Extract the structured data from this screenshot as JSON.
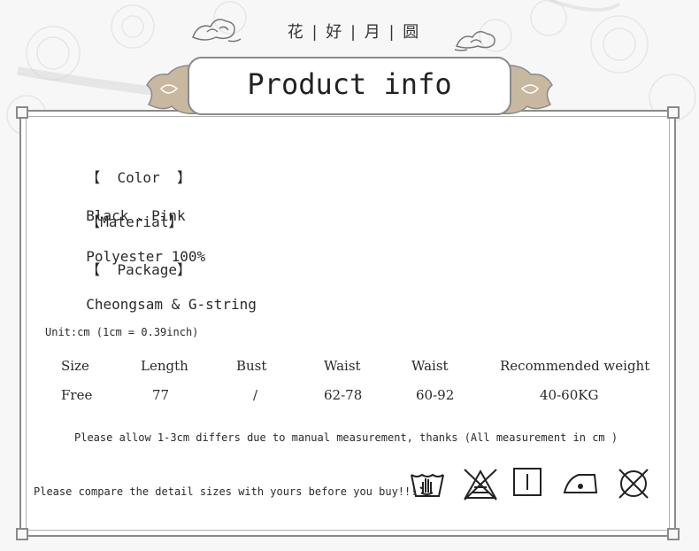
{
  "header": {
    "chinese_title": "花 | 好 | 月 | 圆",
    "banner_title": "Product info"
  },
  "details": [
    {
      "label": "【  Color  】",
      "value": "Black 、Pink"
    },
    {
      "label": "【Material】",
      "value": "Polyester 100%"
    },
    {
      "label": "【  Package】",
      "value": "Cheongsam & G-string"
    }
  ],
  "size_chart": {
    "unit_note": "Unit:cm (1cm = 0.39inch)",
    "columns": [
      "Size",
      "Length",
      "Bust",
      "Waist",
      "Waist",
      "Recommended weight"
    ],
    "rows": [
      [
        "Free",
        "77",
        "/",
        "62-78",
        "60-92",
        "40-60KG"
      ]
    ]
  },
  "measurement_note": "Please allow 1-3cm differs due to manual measurement, thanks (All measurement in cm )",
  "compare_note": "Please compare the detail sizes with yours before you buy!!!",
  "care_icons": [
    "hand-wash-icon",
    "do-not-bleach-icon",
    "line-dry-icon",
    "low-iron-icon",
    "do-not-dry-clean-icon"
  ],
  "colors": {
    "frame": "#8a8a8a",
    "wing": "#c9b8a0",
    "background": "#f7f7f7"
  }
}
